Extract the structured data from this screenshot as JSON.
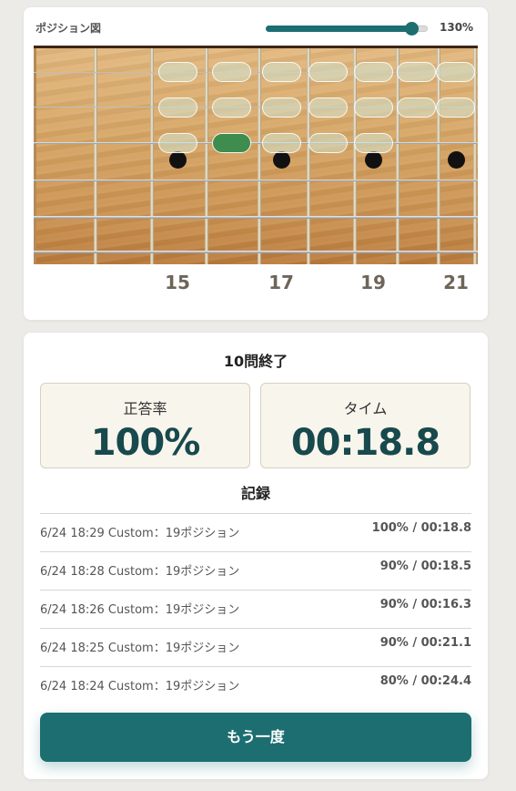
{
  "board": {
    "title": "ポジション図",
    "zoom_label": "130%",
    "zoom_fraction": 0.9,
    "fret_numbers": [
      "15",
      "17",
      "19",
      "21"
    ]
  },
  "result": {
    "title": "10問終了",
    "accuracy_label": "正答率",
    "accuracy_value": "100%",
    "time_label": "タイム",
    "time_value": "00:18.8",
    "records_title": "記録",
    "records": [
      {
        "left": "6/24 18:29 Custom：19ポジション",
        "right": "100% / 00:18.8"
      },
      {
        "left": "6/24 18:28 Custom：19ポジション",
        "right": "90% / 00:18.5"
      },
      {
        "left": "6/24 18:26 Custom：19ポジション",
        "right": "90% / 00:16.3"
      },
      {
        "left": "6/24 18:25 Custom：19ポジション",
        "right": "90% / 00:21.1"
      },
      {
        "left": "6/24 18:24 Custom：19ポジション",
        "right": "80% / 00:24.4"
      }
    ],
    "retry_label": "もう一度"
  },
  "colors": {
    "accent": "#1c6e71",
    "value_text": "#17494d",
    "selected_note": "#3f8c4f"
  }
}
